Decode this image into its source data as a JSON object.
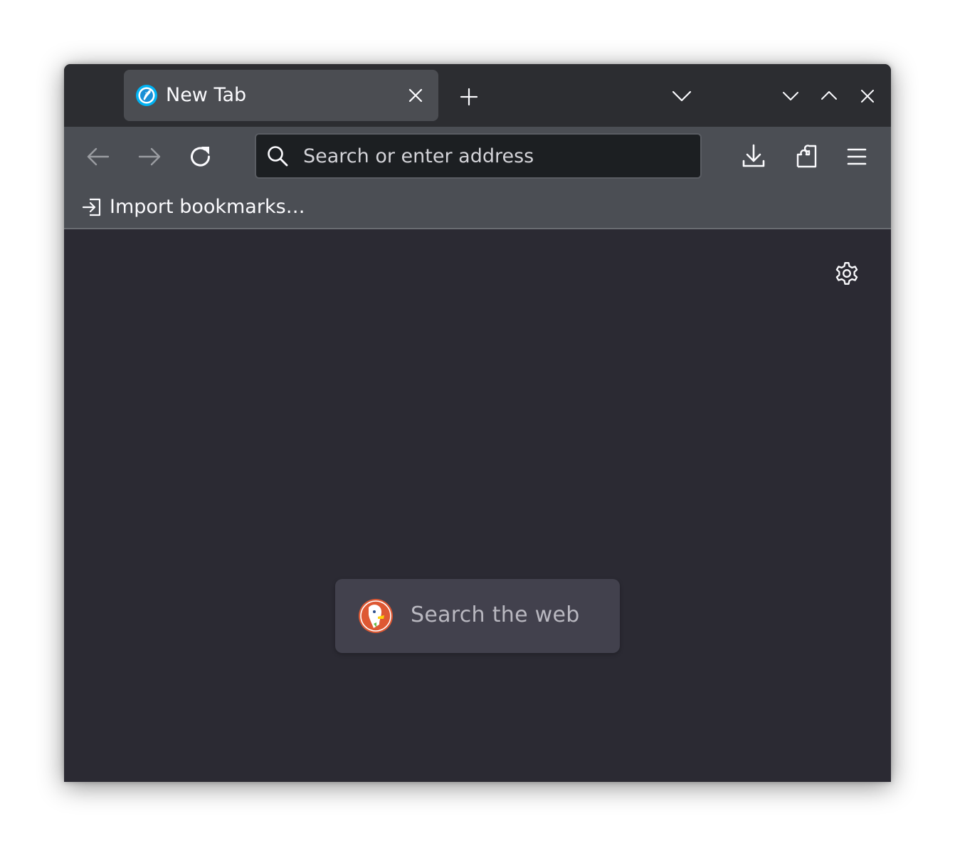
{
  "tabs": [
    {
      "title": "New Tab",
      "favicon": "browser-logo-icon",
      "active": true
    }
  ],
  "navbar": {
    "url_placeholder": "Search or enter address",
    "back_enabled": false,
    "forward_enabled": false
  },
  "bookmarks_bar": {
    "import_label": "Import bookmarks…"
  },
  "content": {
    "web_search_placeholder": "Search the web",
    "search_engine_icon": "duckduckgo-logo-icon"
  },
  "colors": {
    "tabstrip_bg": "#2c2d31",
    "active_tab_bg": "#4b4d52",
    "toolbar_bg": "#4b4e54",
    "urlbar_bg": "#1c1f22",
    "content_bg": "#2b2a33",
    "search_box_bg": "#42414d",
    "text": "#fbfbfe",
    "accent": "#00b3f4"
  }
}
